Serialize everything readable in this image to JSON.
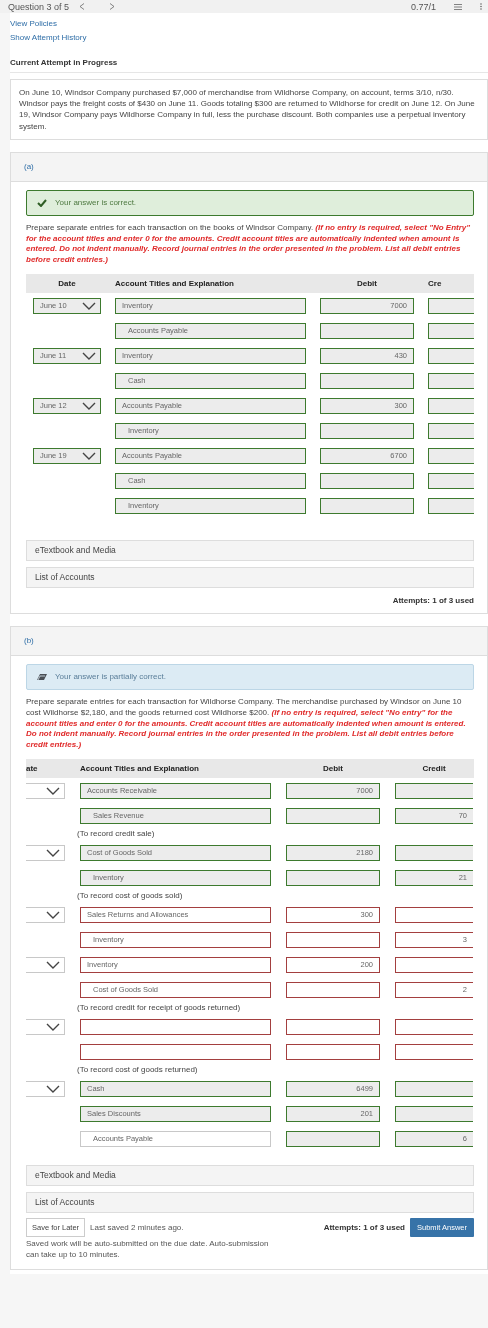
{
  "top_bar": {
    "title": "Question 3 of 5",
    "score": "0.77/1"
  },
  "links": [
    "View Policies",
    "Show Attempt History"
  ],
  "attempt_heading": "Current Attempt in Progress",
  "problem": "On June 10, Windsor Company purchased $7,000 of merchandise from Wildhorse Company, on account, terms 3/10, n/30. Windsor pays the freight costs of $430 on June 11. Goods totaling $300 are returned to Wildhorse for credit on June 12. On June 19, Windsor Company pays Wildhorse Company in full, less the purchase discount. Both companies use a perpetual inventory system.",
  "parts": [
    {
      "label": "(a)",
      "feedback": {
        "kind": "correct",
        "text": "Your answer is correct."
      },
      "instructions": {
        "text": "Prepare separate entries for each transaction on the books of Windsor Company.",
        "note": "(If no entry is required, select \"No Entry\" for the account titles and enter 0 for the amounts. Credit account titles are automatically indented when amount is entered. Do not indent manually. Record journal entries in the order presented in the problem. List all debit entries before credit entries.)"
      },
      "columns": [
        "Date",
        "Account Titles and Explanation",
        "Debit",
        "Cre"
      ],
      "entries": [
        {
          "date": {
            "value": "June 10",
            "kind": "correct"
          },
          "lines": [
            {
              "account": {
                "value": "Inventory",
                "kind": "correct",
                "indented": false
              },
              "debit": {
                "value": "7000",
                "kind": "correct"
              },
              "credit": {
                "kind": "correct"
              }
            },
            {
              "account": {
                "value": "Accounts Payable",
                "kind": "correct",
                "indented": true
              },
              "debit": {
                "kind": "correct"
              },
              "credit": {
                "kind": "correct"
              }
            }
          ]
        },
        {
          "date": {
            "value": "June 11",
            "kind": "correct"
          },
          "lines": [
            {
              "account": {
                "value": "Inventory",
                "kind": "correct",
                "indented": false
              },
              "debit": {
                "value": "430",
                "kind": "correct"
              },
              "credit": {
                "kind": "correct"
              }
            },
            {
              "account": {
                "value": "Cash",
                "kind": "correct",
                "indented": true
              },
              "debit": {
                "kind": "correct"
              },
              "credit": {
                "kind": "correct"
              }
            }
          ]
        },
        {
          "date": {
            "value": "June 12",
            "kind": "correct"
          },
          "lines": [
            {
              "account": {
                "value": "Accounts Payable",
                "kind": "correct",
                "indented": false
              },
              "debit": {
                "value": "300",
                "kind": "correct"
              },
              "credit": {
                "kind": "correct"
              }
            },
            {
              "account": {
                "value": "Inventory",
                "kind": "correct",
                "indented": true
              },
              "debit": {
                "kind": "correct"
              },
              "credit": {
                "kind": "correct"
              }
            }
          ]
        },
        {
          "date": {
            "value": "June 19",
            "kind": "correct"
          },
          "lines": [
            {
              "account": {
                "value": "Accounts Payable",
                "kind": "correct",
                "indented": false
              },
              "debit": {
                "value": "6700",
                "kind": "correct"
              },
              "credit": {
                "kind": "correct"
              }
            },
            {
              "account": {
                "value": "Cash",
                "kind": "correct",
                "indented": true
              },
              "debit": {
                "kind": "correct"
              },
              "credit": {
                "kind": "correct"
              }
            },
            {
              "account": {
                "value": "Inventory",
                "kind": "correct",
                "indented": true
              },
              "debit": {
                "kind": "correct"
              },
              "credit": {
                "kind": "correct"
              }
            }
          ]
        }
      ],
      "links": [
        "eTextbook and Media",
        "List of Accounts"
      ],
      "attempts": "Attempts: 1 of 3 used"
    },
    {
      "label": "(b)",
      "feedback": {
        "kind": "partial",
        "text": "Your answer is partially correct."
      },
      "instructions": {
        "text": "Prepare separate entries for each transaction for Wildhorse Company. The merchandise purchased by Windsor on June 10 cost Wildhorse $2,180, and the goods returned cost Wildhorse $200.",
        "note": "(If no entry is required, select \"No entry\" for the account titles and enter 0 for the amounts. Credit account titles are automatically indented when amount is entered. Do not indent manually. Record journal entries in the order presented in the problem. List all debit entries before credit entries.)"
      },
      "columns": [
        "ate",
        "Account Titles and Explanation",
        "Debit",
        "Credit"
      ],
      "entries": [
        {
          "date": {
            "kind": "neutral"
          },
          "lines": [
            {
              "account": {
                "value": "Accounts Receivable",
                "kind": "correct",
                "indented": false
              },
              "debit": {
                "value": "7000",
                "kind": "correct"
              },
              "credit": {
                "kind": "correct"
              }
            },
            {
              "account": {
                "value": "Sales Revenue",
                "kind": "correct",
                "indented": true
              },
              "debit": {
                "kind": "correct"
              },
              "credit": {
                "value": "70",
                "kind": "correct"
              }
            }
          ],
          "explanation": "(To record credit sale)"
        },
        {
          "date": {
            "kind": "neutral"
          },
          "lines": [
            {
              "account": {
                "value": "Cost of Goods Sold",
                "kind": "correct",
                "indented": false
              },
              "debit": {
                "value": "2180",
                "kind": "correct"
              },
              "credit": {
                "kind": "correct"
              }
            },
            {
              "account": {
                "value": "Inventory",
                "kind": "correct",
                "indented": true
              },
              "debit": {
                "kind": "correct"
              },
              "credit": {
                "value": "21",
                "kind": "correct"
              }
            }
          ],
          "explanation": "(To record cost of goods sold)"
        },
        {
          "date": {
            "kind": "neutral"
          },
          "lines": [
            {
              "account": {
                "value": "Sales Returns and Allowances",
                "kind": "incorrect",
                "indented": false
              },
              "debit": {
                "value": "300",
                "kind": "incorrect"
              },
              "credit": {
                "kind": "incorrect"
              }
            },
            {
              "account": {
                "value": "Inventory",
                "kind": "incorrect",
                "indented": true
              },
              "debit": {
                "kind": "incorrect"
              },
              "credit": {
                "value": "3",
                "kind": "incorrect"
              }
            }
          ]
        },
        {
          "date": {
            "kind": "neutral"
          },
          "lines": [
            {
              "account": {
                "value": "Inventory",
                "kind": "incorrect",
                "indented": false
              },
              "debit": {
                "value": "200",
                "kind": "incorrect"
              },
              "credit": {
                "kind": "incorrect"
              }
            },
            {
              "account": {
                "value": "Cost of Goods Sold",
                "kind": "incorrect",
                "indented": true
              },
              "debit": {
                "kind": "incorrect"
              },
              "credit": {
                "value": "2",
                "kind": "incorrect"
              }
            }
          ],
          "explanation": "(To record credit for receipt of goods returned)"
        },
        {
          "date": {
            "kind": "neutral"
          },
          "lines": [
            {
              "account": {
                "kind": "incorrect"
              },
              "debit": {
                "kind": "incorrect"
              },
              "credit": {
                "kind": "incorrect"
              }
            },
            {
              "account": {
                "kind": "incorrect"
              },
              "debit": {
                "kind": "incorrect"
              },
              "credit": {
                "kind": "incorrect"
              }
            }
          ],
          "explanation": "(To record cost of goods returned)"
        },
        {
          "date": {
            "kind": "neutral"
          },
          "lines": [
            {
              "account": {
                "value": "Cash",
                "kind": "correct",
                "indented": false
              },
              "debit": {
                "value": "6499",
                "kind": "correct"
              },
              "credit": {
                "kind": "correct"
              }
            },
            {
              "account": {
                "value": "Sales Discounts",
                "kind": "correct",
                "indented": false
              },
              "debit": {
                "value": "201",
                "kind": "correct"
              },
              "credit": {
                "kind": "correct"
              }
            },
            {
              "account": {
                "value": "Accounts Payable",
                "kind": "neutral",
                "indented": true
              },
              "debit": {
                "kind": "correct"
              },
              "credit": {
                "value": "6",
                "kind": "correct"
              }
            }
          ]
        }
      ],
      "links": [
        "eTextbook and Media",
        "List of Accounts"
      ],
      "footer": {
        "save_button": "Save for Later",
        "last_saved": "Last saved 2 minutes ago.",
        "note": "Saved work will be auto-submitted on the due date. Auto-submission can take up to 10 minutes.",
        "submit_button": "Submit Answer"
      },
      "attempts": "Attempts: 1 of 3 used"
    }
  ]
}
